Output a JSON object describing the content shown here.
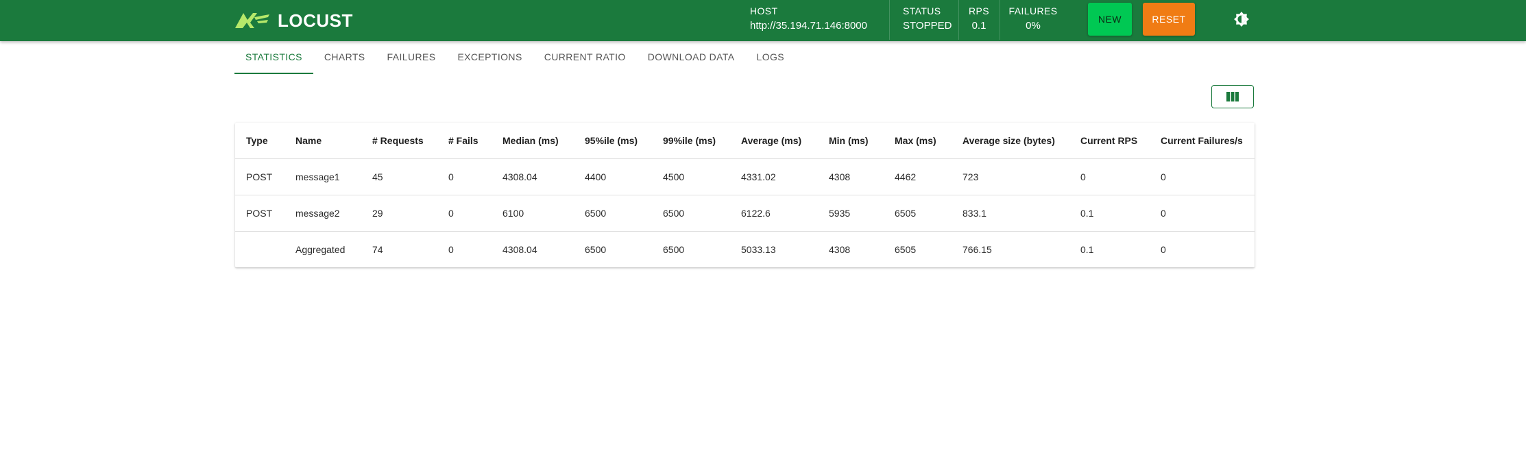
{
  "app": {
    "name": "LOCUST"
  },
  "header": {
    "host": {
      "label": "HOST",
      "value": "http://35.194.71.146:8000"
    },
    "status": {
      "label": "STATUS",
      "value": "STOPPED"
    },
    "rps": {
      "label": "RPS",
      "value": "0.1"
    },
    "failures": {
      "label": "FAILURES",
      "value": "0%"
    },
    "new_label": "NEW",
    "reset_label": "RESET"
  },
  "tabs": [
    {
      "label": "STATISTICS",
      "active": true
    },
    {
      "label": "CHARTS"
    },
    {
      "label": "FAILURES"
    },
    {
      "label": "EXCEPTIONS"
    },
    {
      "label": "CURRENT RATIO"
    },
    {
      "label": "DOWNLOAD DATA"
    },
    {
      "label": "LOGS"
    }
  ],
  "table": {
    "columns": [
      "Type",
      "Name",
      "# Requests",
      "# Fails",
      "Median (ms)",
      "95%ile (ms)",
      "99%ile (ms)",
      "Average (ms)",
      "Min (ms)",
      "Max (ms)",
      "Average size (bytes)",
      "Current RPS",
      "Current Failures/s"
    ],
    "rows": [
      [
        "POST",
        "message1",
        "45",
        "0",
        "4308.04",
        "4400",
        "4500",
        "4331.02",
        "4308",
        "4462",
        "723",
        "0",
        "0"
      ],
      [
        "POST",
        "message2",
        "29",
        "0",
        "6100",
        "6500",
        "6500",
        "6122.6",
        "5935",
        "6505",
        "833.1",
        "0.1",
        "0"
      ],
      [
        "",
        "Aggregated",
        "74",
        "0",
        "4308.04",
        "6500",
        "6500",
        "5033.13",
        "4308",
        "6505",
        "766.15",
        "0.1",
        "0"
      ]
    ]
  },
  "colors": {
    "primary": "#1b7a3d",
    "new_button": "#00c853",
    "reset_button": "#f07c14"
  },
  "icons": {
    "logo": "locust-logo-icon",
    "theme": "theme-toggle-icon",
    "columns": "view-columns-icon"
  }
}
